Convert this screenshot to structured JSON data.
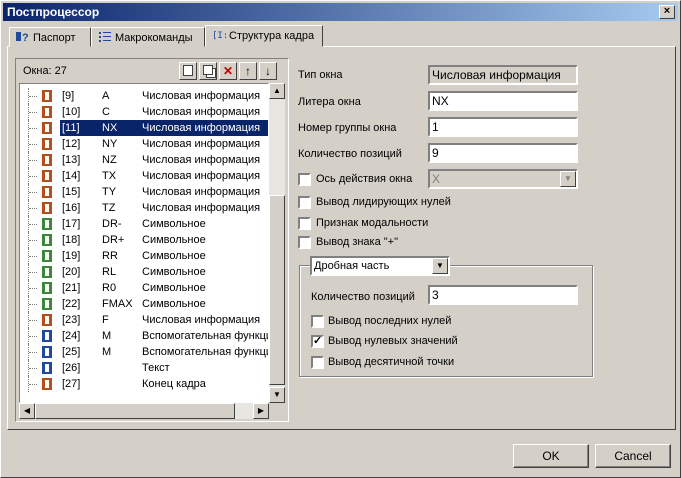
{
  "window": {
    "title": "Постпроцессор"
  },
  "tabs": [
    {
      "label": "Паспорт",
      "icon": "help-icon"
    },
    {
      "label": "Макрокоманды",
      "icon": "macro-icon"
    },
    {
      "label": "Структура кадра",
      "icon": "frame-structure-icon"
    }
  ],
  "list": {
    "count_label": "Окна: 27",
    "toolbar": [
      "new-window-icon",
      "copy-icon",
      "delete-icon",
      "move-up-icon",
      "move-down-icon"
    ],
    "rows": [
      {
        "num": "[9]",
        "lit": "A",
        "type": "Числовая информация",
        "color": "red"
      },
      {
        "num": "[10]",
        "lit": "C",
        "type": "Числовая информация",
        "color": "red"
      },
      {
        "num": "[11]",
        "lit": "NX",
        "type": "Числовая информация",
        "color": "red",
        "selected": true
      },
      {
        "num": "[12]",
        "lit": "NY",
        "type": "Числовая информация",
        "color": "red"
      },
      {
        "num": "[13]",
        "lit": "NZ",
        "type": "Числовая информация",
        "color": "red"
      },
      {
        "num": "[14]",
        "lit": "TX",
        "type": "Числовая информация",
        "color": "red"
      },
      {
        "num": "[15]",
        "lit": "TY",
        "type": "Числовая информация",
        "color": "red"
      },
      {
        "num": "[16]",
        "lit": "TZ",
        "type": "Числовая информация",
        "color": "red"
      },
      {
        "num": "[17]",
        "lit": "DR-",
        "type": "Символьное",
        "color": "green"
      },
      {
        "num": "[18]",
        "lit": "DR+",
        "type": "Символьное",
        "color": "green"
      },
      {
        "num": "[19]",
        "lit": "RR",
        "type": "Символьное",
        "color": "green"
      },
      {
        "num": "[20]",
        "lit": "RL",
        "type": "Символьное",
        "color": "green"
      },
      {
        "num": "[21]",
        "lit": "R0",
        "type": "Символьное",
        "color": "green"
      },
      {
        "num": "[22]",
        "lit": "FMAX",
        "type": "Символьное",
        "color": "green"
      },
      {
        "num": "[23]",
        "lit": "F",
        "type": "Числовая информация",
        "color": "red"
      },
      {
        "num": "[24]",
        "lit": "M",
        "type": "Вспомогательная функци",
        "color": "blue"
      },
      {
        "num": "[25]",
        "lit": "M",
        "type": "Вспомогательная функци",
        "color": "blue"
      },
      {
        "num": "[26]",
        "lit": "",
        "type": "Текст",
        "color": "blue"
      },
      {
        "num": "[27]",
        "lit": "",
        "type": "Конец кадра",
        "color": "red"
      }
    ]
  },
  "props": {
    "window_type_label": "Тип окна",
    "window_type_value": "Числовая информация",
    "letter_label": "Литера окна",
    "letter_value": "NX",
    "group_label": "Номер группы окна",
    "group_value": "1",
    "positions_label": "Количество позиций",
    "positions_value": "9",
    "axis_label": "Ось действия окна",
    "axis_value": "X",
    "lead_zeros_label": "Вывод лидирующих нулей",
    "modal_label": "Признак модальности",
    "plus_sign_label": "Вывод знака \"+\""
  },
  "fraction": {
    "select_value": "Дробная часть",
    "positions_label": "Количество позиций",
    "positions_value": "3",
    "trailing_zeros_label": "Вывод последних нулей",
    "zero_values_label": "Вывод нулевых значений",
    "zero_values_checked": true,
    "decimal_point_label": "Вывод десятичной точки"
  },
  "buttons": {
    "ok": "OK",
    "cancel": "Cancel"
  }
}
